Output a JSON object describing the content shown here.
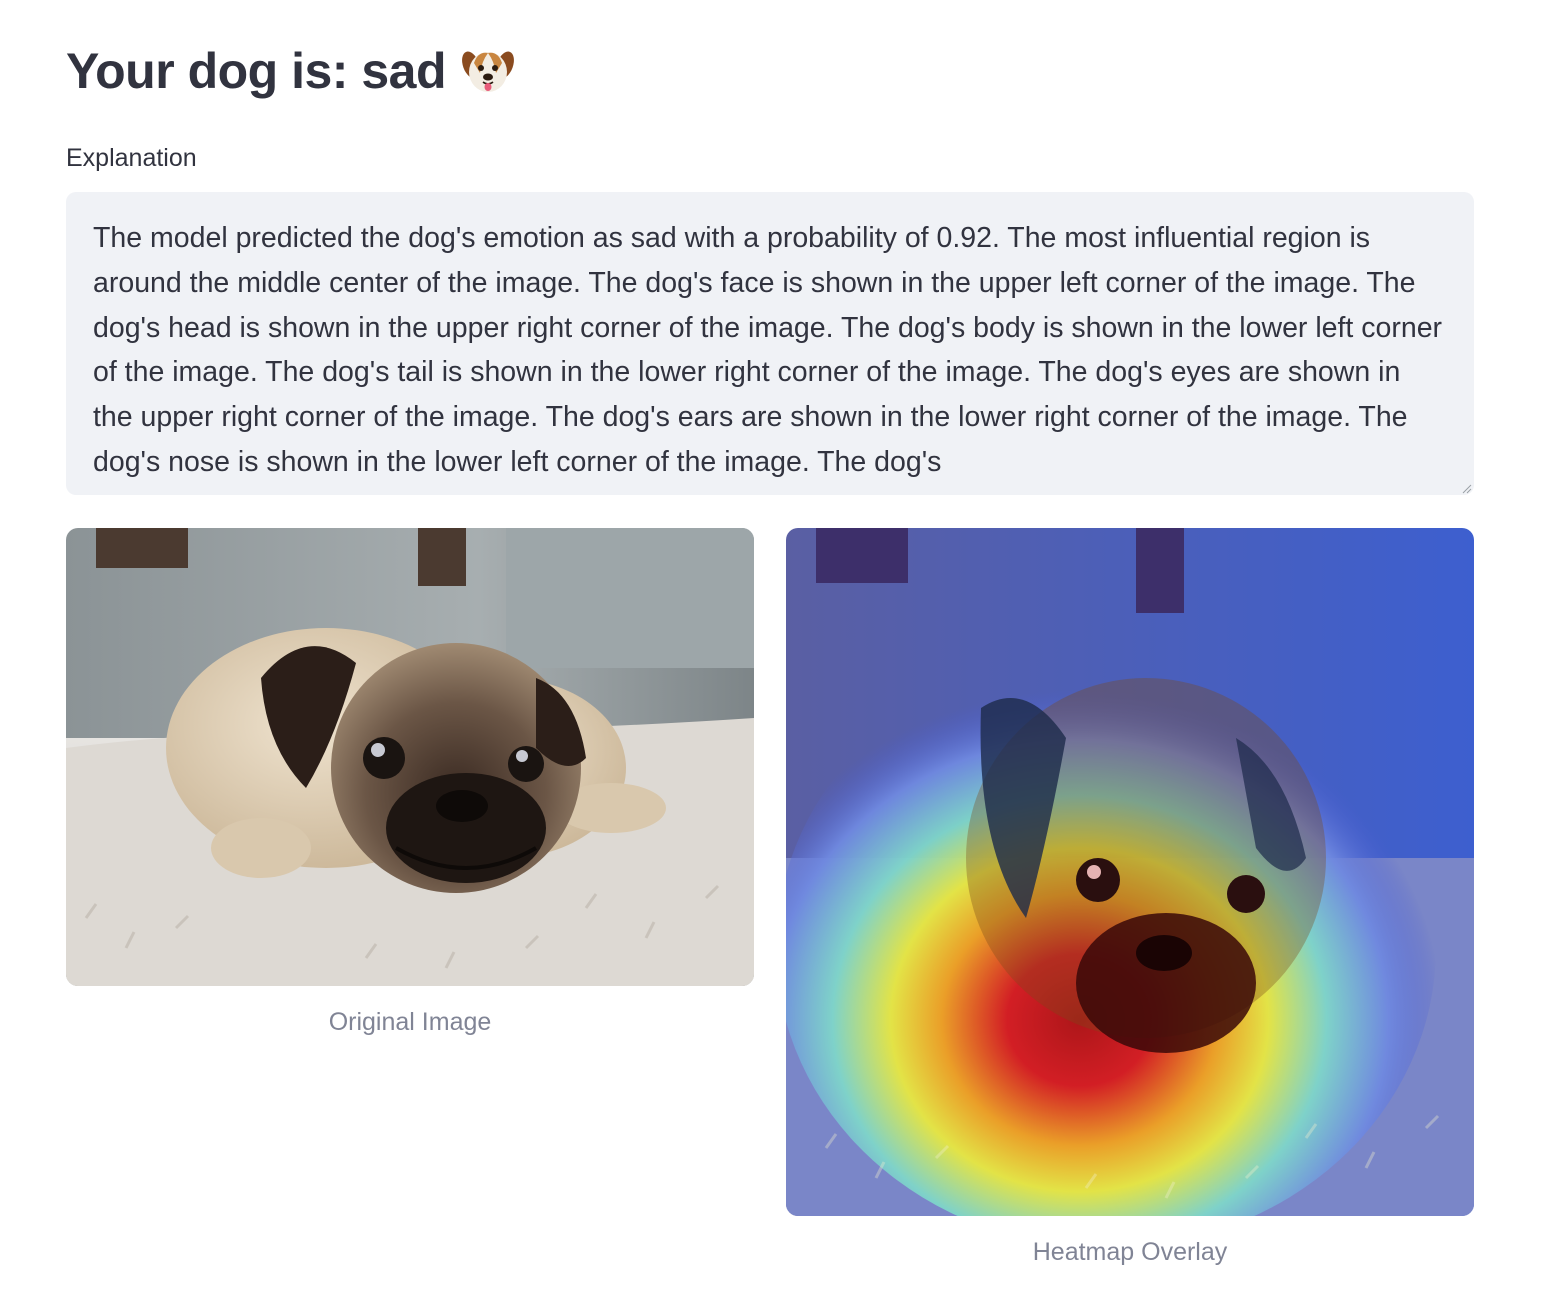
{
  "header": {
    "title": "Your dog is: sad",
    "title_icon": "dog-face-icon"
  },
  "explanation": {
    "label": "Explanation",
    "text": "The model predicted the dog's emotion as sad with a probability of 0.92. The most influential region is around the middle center of the image. The dog's face is shown in the upper left corner of the image. The dog's head is shown in the upper right corner of the image. The dog's body is shown in the lower left corner of the image. The dog's tail is shown in the lower right corner of the image. The dog's eyes are shown in the upper right corner of the image. The dog's ears are shown in the lower right corner of the image. The dog's nose is shown in the lower left corner of the image. The dog's"
  },
  "images": {
    "original_caption": "Original Image",
    "heatmap_caption": "Heatmap Overlay"
  },
  "colors": {
    "text": "#31333f",
    "caption": "#808495",
    "textarea_bg": "#f0f2f6",
    "heatmap_hot": "#d7191c",
    "heatmap_cold": "#2c3fd1"
  }
}
